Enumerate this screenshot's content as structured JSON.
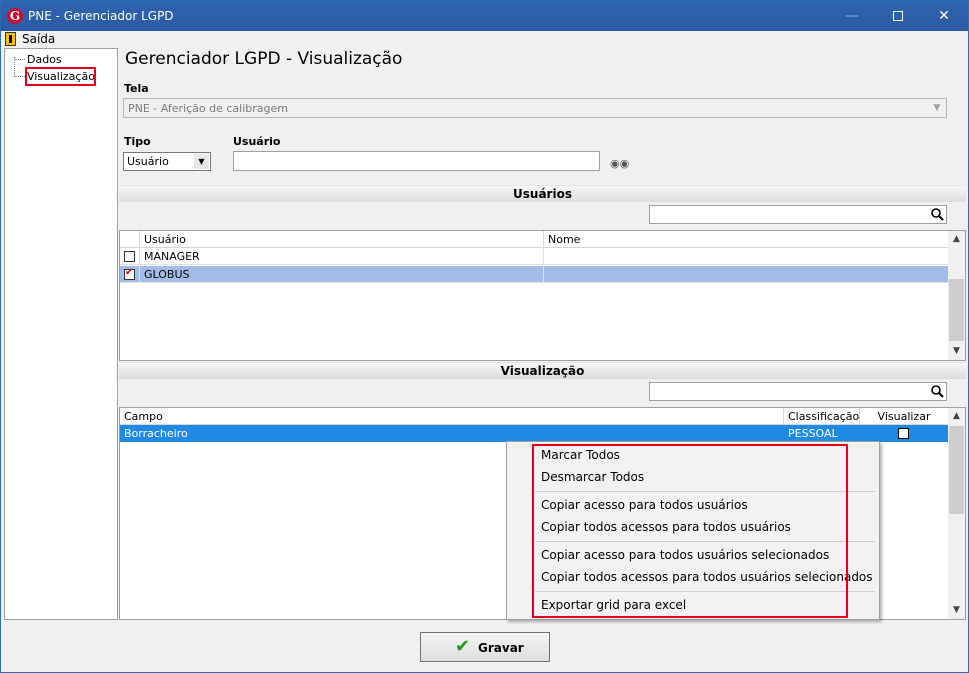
{
  "window": {
    "title": "PNE - Gerenciador LGPD"
  },
  "menu": {
    "exit_label": "Saída"
  },
  "tree": {
    "items": [
      "Dados",
      "Visualização"
    ],
    "selected": "Visualização"
  },
  "page": {
    "title": "Gerenciador LGPD - Visualização"
  },
  "tela": {
    "label": "Tela",
    "value": "PNE - Aferição de calibragem"
  },
  "tipo": {
    "label": "Tipo",
    "value": "Usuário"
  },
  "usuario": {
    "label": "Usuário",
    "value": ""
  },
  "usuarios_section": {
    "title": "Usuários",
    "search_value": "",
    "columns": [
      "Usuário",
      "Nome"
    ],
    "rows": [
      {
        "checked": false,
        "usuario": "MANAGER",
        "nome": ""
      },
      {
        "checked": true,
        "usuario": "GLOBUS",
        "nome": ""
      }
    ]
  },
  "visualizacao_section": {
    "title": "Visualização",
    "search_value": "",
    "columns": [
      "Campo",
      "Classificação",
      "Visualizar"
    ],
    "rows": [
      {
        "campo": "Borracheiro",
        "classificacao": "PESSOAL",
        "visualizar": false
      }
    ]
  },
  "context_menu": {
    "items": [
      "Marcar Todos",
      "Desmarcar Todos",
      "Copiar acesso para todos usuários",
      "Copiar todos acessos para todos usuários",
      "Copiar acesso para todos usuários selecionados",
      "Copiar todos acessos para todos usuários selecionados",
      "Exportar grid para excel"
    ]
  },
  "footer": {
    "save_label": "Gravar"
  },
  "colors": {
    "titlebar": "#2b5aa3",
    "selection": "#a3bde8",
    "row_selected_blue": "#1f8ae6",
    "highlight_red": "#e2001a"
  }
}
